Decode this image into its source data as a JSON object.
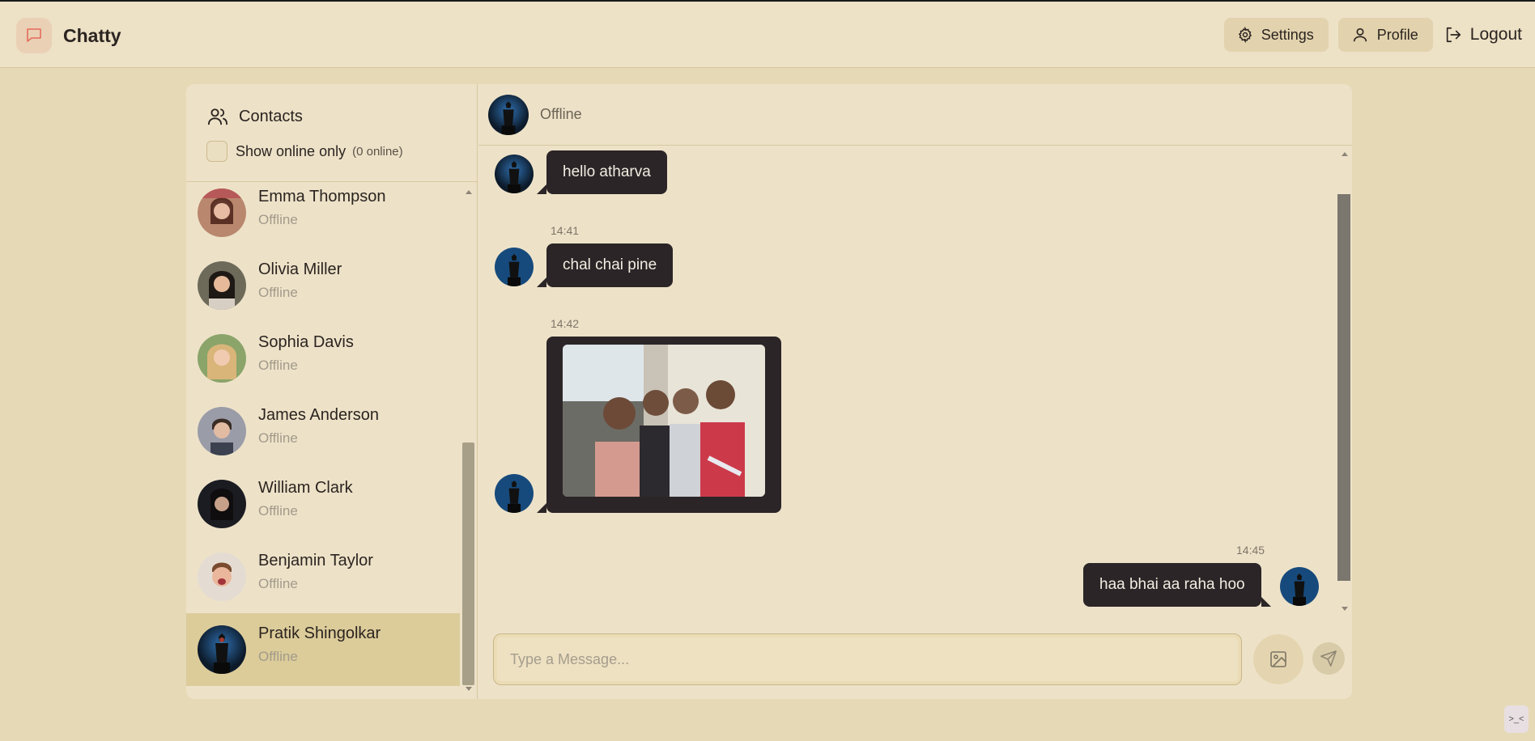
{
  "app": {
    "name": "Chatty"
  },
  "nav": {
    "settings": "Settings",
    "profile": "Profile",
    "logout": "Logout"
  },
  "sidebar": {
    "title": "Contacts",
    "filter_label": "Show online only",
    "online_count": "(0 online)",
    "contacts": [
      {
        "name": "Emma Thompson",
        "status": "Offline"
      },
      {
        "name": "Olivia Miller",
        "status": "Offline"
      },
      {
        "name": "Sophia Davis",
        "status": "Offline"
      },
      {
        "name": "James Anderson",
        "status": "Offline"
      },
      {
        "name": "William Clark",
        "status": "Offline"
      },
      {
        "name": "Benjamin Taylor",
        "status": "Offline"
      },
      {
        "name": "Pratik Shingolkar",
        "status": "Offline"
      }
    ]
  },
  "chat": {
    "status": "Offline",
    "messages": [
      {
        "direction": "in",
        "text": "hello atharva",
        "time": ""
      },
      {
        "direction": "in",
        "text": "chal chai pine",
        "time": "14:41"
      },
      {
        "direction": "in",
        "text": "",
        "time": "14:42",
        "has_image": true
      },
      {
        "direction": "out",
        "text": "haa bhai aa raha hoo",
        "time": "14:45"
      }
    ],
    "input_placeholder": "Type a Message..."
  },
  "colors": {
    "background": "#e6d9b6",
    "panel": "#ede2c8",
    "bubble": "#2b2527",
    "active_contact": "#dccc9a",
    "brand_icon": "#e56b5d"
  }
}
